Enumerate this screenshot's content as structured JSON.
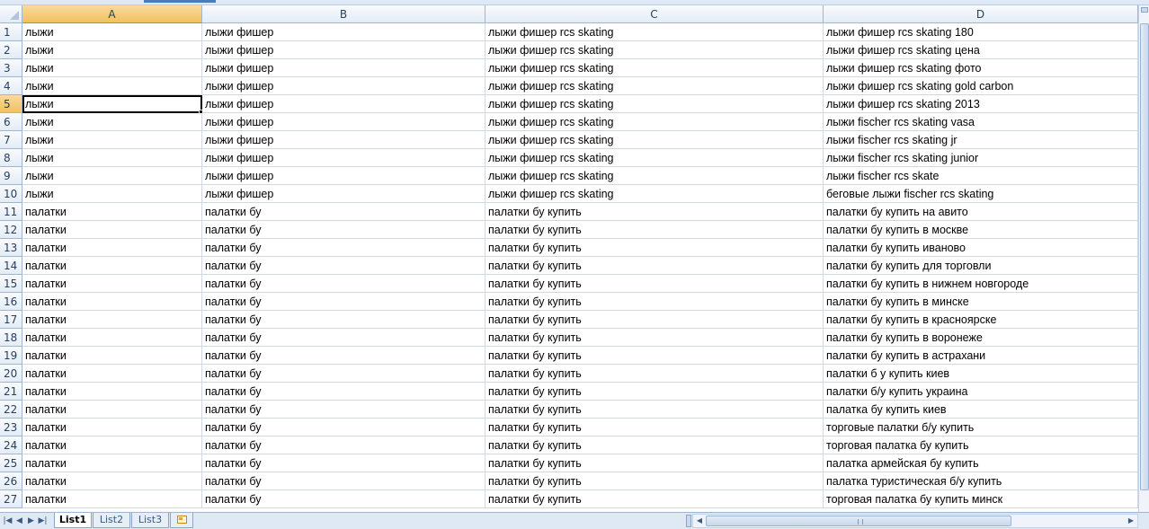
{
  "columns": [
    "A",
    "B",
    "C",
    "D"
  ],
  "active_cell": {
    "row": 5,
    "col": "A"
  },
  "rows": [
    {
      "n": "1",
      "a": "лыжи",
      "b": "лыжи фишер",
      "c": "лыжи фишер rcs skating",
      "d": "лыжи фишер rcs skating 180"
    },
    {
      "n": "2",
      "a": "лыжи",
      "b": "лыжи фишер",
      "c": "лыжи фишер rcs skating",
      "d": "лыжи фишер rcs skating цена"
    },
    {
      "n": "3",
      "a": "лыжи",
      "b": "лыжи фишер",
      "c": "лыжи фишер rcs skating",
      "d": "лыжи фишер rcs skating фото"
    },
    {
      "n": "4",
      "a": "лыжи",
      "b": "лыжи фишер",
      "c": "лыжи фишер rcs skating",
      "d": "лыжи фишер rcs skating gold carbon"
    },
    {
      "n": "5",
      "a": "лыжи",
      "b": "лыжи фишер",
      "c": "лыжи фишер rcs skating",
      "d": "лыжи фишер rcs skating 2013"
    },
    {
      "n": "6",
      "a": "лыжи",
      "b": "лыжи фишер",
      "c": "лыжи фишер rcs skating",
      "d": "лыжи fischer rcs skating vasa"
    },
    {
      "n": "7",
      "a": "лыжи",
      "b": "лыжи фишер",
      "c": "лыжи фишер rcs skating",
      "d": "лыжи fischer rcs skating jr"
    },
    {
      "n": "8",
      "a": "лыжи",
      "b": "лыжи фишер",
      "c": "лыжи фишер rcs skating",
      "d": "лыжи fischer rcs skating junior"
    },
    {
      "n": "9",
      "a": "лыжи",
      "b": "лыжи фишер",
      "c": "лыжи фишер rcs skating",
      "d": "лыжи fischer rcs skate"
    },
    {
      "n": "10",
      "a": "лыжи",
      "b": "лыжи фишер",
      "c": "лыжи фишер rcs skating",
      "d": "беговые лыжи fischer rcs skating"
    },
    {
      "n": "11",
      "a": "палатки",
      "b": "палатки бу",
      "c": "палатки бу купить",
      "d": "палатки бу купить на авито"
    },
    {
      "n": "12",
      "a": "палатки",
      "b": "палатки бу",
      "c": "палатки бу купить",
      "d": "палатки бу купить в москве"
    },
    {
      "n": "13",
      "a": "палатки",
      "b": "палатки бу",
      "c": "палатки бу купить",
      "d": "палатки бу купить иваново"
    },
    {
      "n": "14",
      "a": "палатки",
      "b": "палатки бу",
      "c": "палатки бу купить",
      "d": "палатки бу купить для торговли"
    },
    {
      "n": "15",
      "a": "палатки",
      "b": "палатки бу",
      "c": "палатки бу купить",
      "d": "палатки бу купить в нижнем новгороде"
    },
    {
      "n": "16",
      "a": "палатки",
      "b": "палатки бу",
      "c": "палатки бу купить",
      "d": "палатки бу купить в минске"
    },
    {
      "n": "17",
      "a": "палатки",
      "b": "палатки бу",
      "c": "палатки бу купить",
      "d": "палатки бу купить в красноярске"
    },
    {
      "n": "18",
      "a": "палатки",
      "b": "палатки бу",
      "c": "палатки бу купить",
      "d": "палатки бу купить в воронеже"
    },
    {
      "n": "19",
      "a": "палатки",
      "b": "палатки бу",
      "c": "палатки бу купить",
      "d": "палатки бу купить в астрахани"
    },
    {
      "n": "20",
      "a": "палатки",
      "b": "палатки бу",
      "c": "палатки бу купить",
      "d": "палатки б у купить киев"
    },
    {
      "n": "21",
      "a": "палатки",
      "b": "палатки бу",
      "c": "палатки бу купить",
      "d": "палатки б/у купить украина"
    },
    {
      "n": "22",
      "a": "палатки",
      "b": "палатки бу",
      "c": "палатки бу купить",
      "d": "палатка бу купить киев"
    },
    {
      "n": "23",
      "a": "палатки",
      "b": "палатки бу",
      "c": "палатки бу купить",
      "d": "торговые палатки б/у купить"
    },
    {
      "n": "24",
      "a": "палатки",
      "b": "палатки бу",
      "c": "палатки бу купить",
      "d": "торговая палатка бу купить"
    },
    {
      "n": "25",
      "a": "палатки",
      "b": "палатки бу",
      "c": "палатки бу купить",
      "d": "палатка армейская бу купить"
    },
    {
      "n": "26",
      "a": "палатки",
      "b": "палатки бу",
      "c": "палатки бу купить",
      "d": "палатка туристическая б/у купить"
    },
    {
      "n": "27",
      "a": "палатки",
      "b": "палатки бу",
      "c": "палатки бу купить",
      "d": "торговая палатка бу купить минск"
    }
  ],
  "sheet_tabs": [
    {
      "label": "List1",
      "active": true
    },
    {
      "label": "List2",
      "active": false
    },
    {
      "label": "List3",
      "active": false
    }
  ],
  "icons": {
    "nav_first": "first-sheet-icon",
    "nav_prev": "prev-sheet-icon",
    "nav_next": "next-sheet-icon",
    "nav_last": "last-sheet-icon",
    "insert_sheet": "insert-sheet-icon"
  }
}
